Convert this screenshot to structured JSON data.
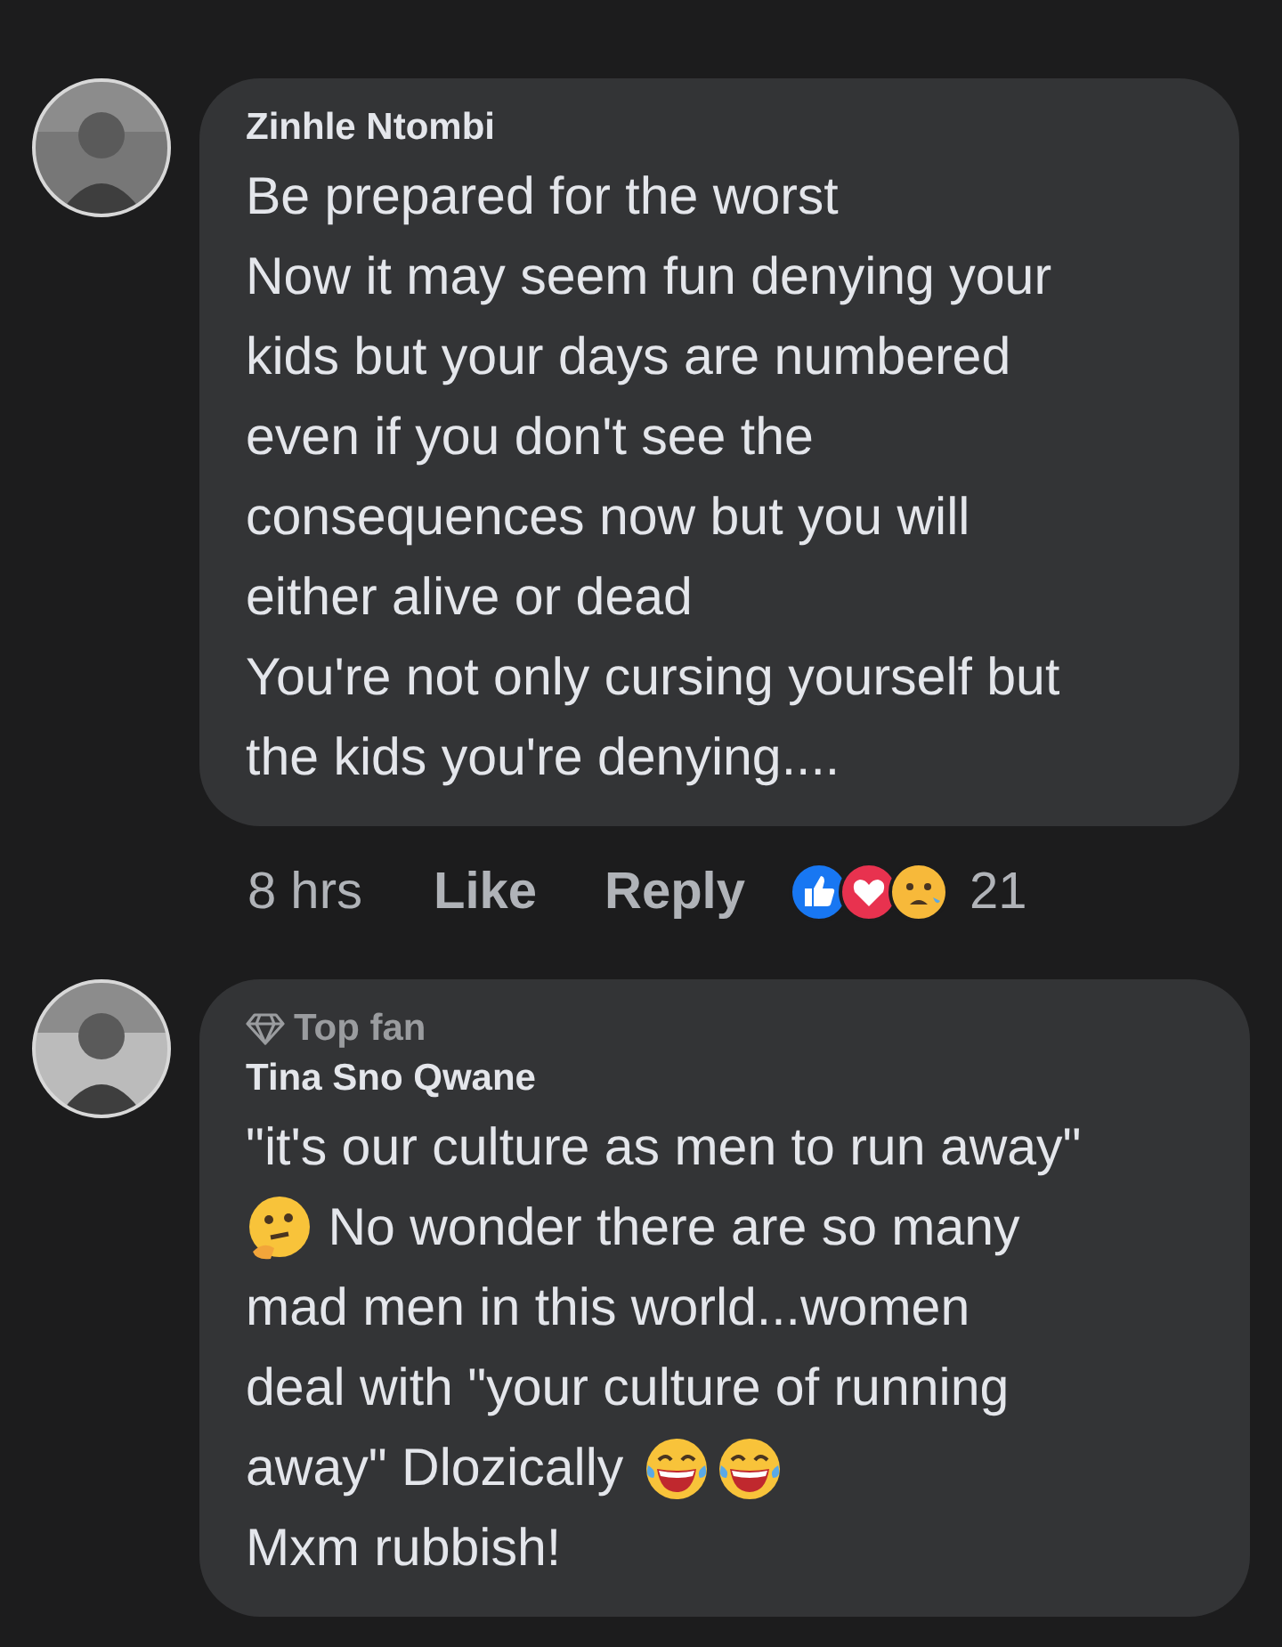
{
  "comments": [
    {
      "author": "Zinhle Ntombi",
      "lines": [
        [
          {
            "kind": "text",
            "text": "Be prepared for the worst"
          }
        ],
        [
          {
            "kind": "text",
            "text": "Now it may seem fun denying your"
          }
        ],
        [
          {
            "kind": "text",
            "text": "kids but your days are numbered"
          }
        ],
        [
          {
            "kind": "text",
            "text": "even if you don't see the"
          }
        ],
        [
          {
            "kind": "text",
            "text": "consequences now but you will"
          }
        ],
        [
          {
            "kind": "text",
            "text": "either alive or dead"
          }
        ],
        [
          {
            "kind": "text",
            "text": "You're not only cursing yourself but"
          }
        ],
        [
          {
            "kind": "text",
            "text": "the kids you're denying...."
          }
        ]
      ],
      "time": "8 hrs",
      "actions": [
        "Like",
        "Reply"
      ],
      "reactions": [
        {
          "kind": "like"
        },
        {
          "kind": "love"
        },
        {
          "kind": "sad"
        }
      ],
      "reaction_count": "21"
    },
    {
      "author": "Tina Sno Qwane",
      "badge": "Top fan",
      "lines": [
        [
          {
            "kind": "text",
            "text": "\"it's our culture as men to run away\""
          }
        ],
        [
          {
            "kind": "thinking"
          },
          {
            "kind": "text",
            "text": " No wonder there are so many"
          }
        ],
        [
          {
            "kind": "text",
            "text": "mad men in this world...women"
          }
        ],
        [
          {
            "kind": "text",
            "text": "deal with \"your culture of running"
          }
        ],
        [
          {
            "kind": "text",
            "text": "away\" Dlozically "
          },
          {
            "kind": "laughing"
          },
          {
            "kind": "laughing"
          }
        ],
        [
          {
            "kind": "text",
            "text": "Mxm rubbish!"
          }
        ]
      ]
    }
  ]
}
